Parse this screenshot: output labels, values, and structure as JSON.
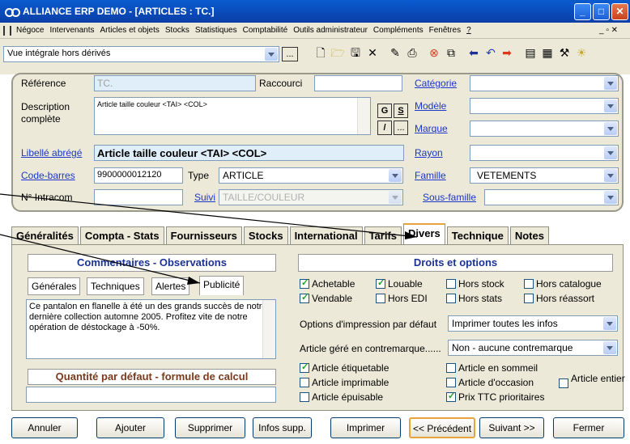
{
  "window": {
    "title": "ALLIANCE ERP DEMO - [ARTICLES : TC.]"
  },
  "menu": [
    "Négoce",
    "Intervenants",
    "Articles et objets",
    "Stocks",
    "Statistiques",
    "Comptabilité",
    "Outils administrateur",
    "Compléments",
    "Fenêtres",
    "?"
  ],
  "toolbar": {
    "view": "Vue intégrale hors dérivés",
    "dots": "..."
  },
  "form": {
    "reference_label": "Référence",
    "reference_value": "TC.",
    "raccourci_label": "Raccourci",
    "description_label": "Description complète",
    "description_value": "Article taille couleur <TAI> <COL>",
    "libelle_label": "Libellé abrégé",
    "libelle_value": "Article taille couleur <TAI> <COL>",
    "codebarres_label": "Code-barres",
    "codebarres_value": "9900000012120",
    "type_label": "Type",
    "type_value": "ARTICLE",
    "intracom_label": "N° Intracom",
    "suivi_label": "Suivi",
    "suivi_value": "TAILLE/COULEUR",
    "categorie_label": "Catégorie",
    "modele_label": "Modèle",
    "marque_label": "Marque",
    "rayon_label": "Rayon",
    "famille_label": "Famille",
    "famille_value": "VETEMENTS",
    "sousfamille_label": "Sous-famille",
    "btn_g": "G",
    "btn_s": "S",
    "btn_slash": "/",
    "btn_dots": "..."
  },
  "tabs": [
    "Généralités",
    "Compta - Stats",
    "Fournisseurs",
    "Stocks",
    "International",
    "Tarifs",
    "Divers",
    "Technique",
    "Notes"
  ],
  "divers": {
    "comments_header": "Commentaires - Observations",
    "subtabs": [
      "Générales",
      "Techniques",
      "Alertes",
      "Publicité"
    ],
    "comment_text": "Ce pantalon en flanelle à été un des grands succès de notre dernière collection automne 2005. Profitez vite de notre opération de déstockage à -50%.",
    "qty_header": "Quantité par défaut - formule de calcul",
    "rights_header": "Droits et options",
    "checks": {
      "achetable": "Achetable",
      "louable": "Louable",
      "hors_stock": "Hors stock",
      "hors_catalogue": "Hors catalogue",
      "vendable": "Vendable",
      "hors_edi": "Hors EDI",
      "hors_stats": "Hors stats",
      "hors_reassort": "Hors réassort",
      "etiquetable": "Article étiquetable",
      "imprimable": "Article imprimable",
      "epuisable": "Article épuisable",
      "sommeil": "Article en sommeil",
      "occasion": "Article d'occasion",
      "prix_ttc": "Prix TTC prioritaires",
      "entier": "Article entier"
    },
    "print_label": "Options d'impression par défaut",
    "print_value": "Imprimer toutes les infos",
    "contremarque_label": "Article géré en contremarque......",
    "contremarque_value": "Non - aucune contremarque"
  },
  "buttons": {
    "annuler": "Annuler",
    "ajouter": "Ajouter",
    "supprimer": "Supprimer",
    "infos": "Infos supp.",
    "imprimer": "Imprimer",
    "precedent": "<< Précédent",
    "suivant": "Suivant >>",
    "fermer": "Fermer"
  },
  "colors": {
    "title_bar": "#0a49b8",
    "link": "#1c36c8",
    "header_blue": "#1a3394",
    "header_brown": "#7a3a1d",
    "tab_active": "#e8a43a"
  }
}
